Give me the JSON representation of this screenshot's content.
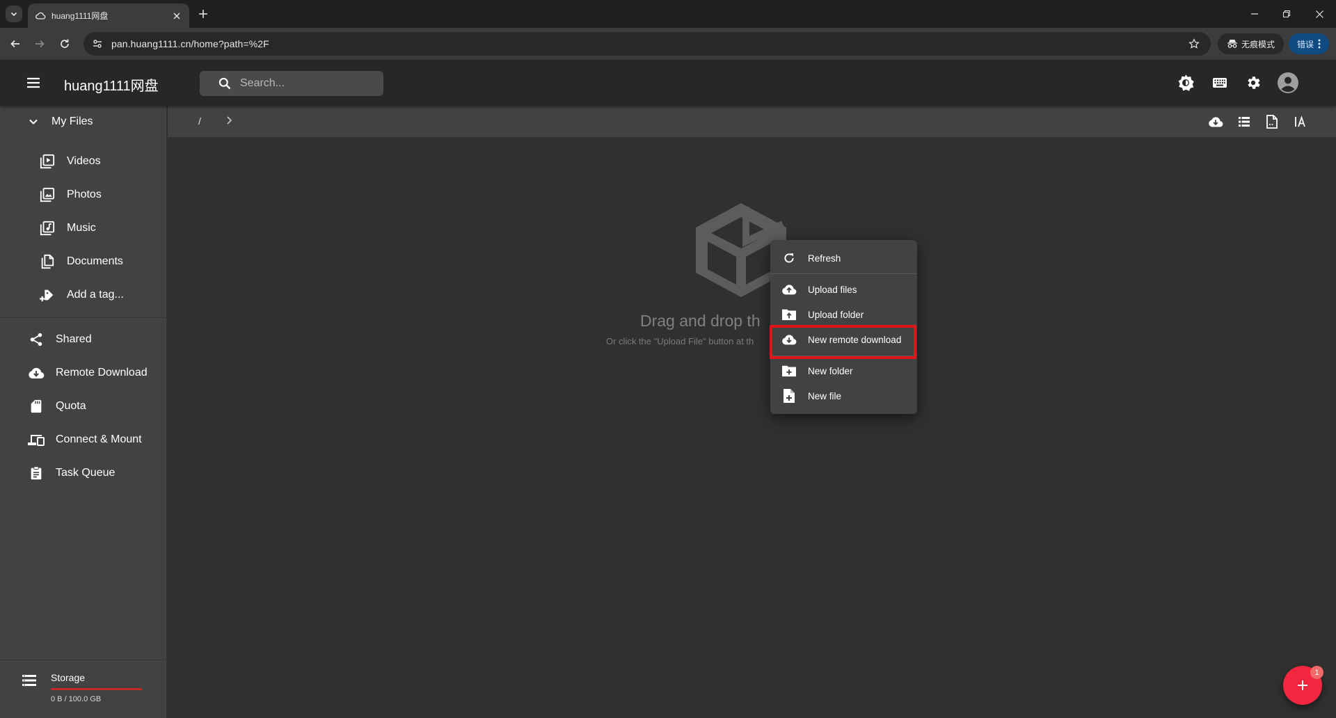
{
  "browser": {
    "tab_title": "huang1111网盘",
    "url": "pan.huang1111.cn/home?path=%2F",
    "incognito_label": "无痕模式",
    "error_label": "错误"
  },
  "header": {
    "title": "huang1111网盘",
    "search_placeholder": "Search..."
  },
  "sidebar": {
    "my_files": "My Files",
    "file_types": [
      {
        "label": "Videos",
        "icon": "video-icon"
      },
      {
        "label": "Photos",
        "icon": "photo-icon"
      },
      {
        "label": "Music",
        "icon": "music-icon"
      },
      {
        "label": "Documents",
        "icon": "documents-icon"
      },
      {
        "label": "Add a tag...",
        "icon": "tag-add-icon"
      }
    ],
    "items": [
      {
        "label": "Shared",
        "icon": "share-icon"
      },
      {
        "label": "Remote Download",
        "icon": "cloud-download-icon"
      },
      {
        "label": "Quota",
        "icon": "sd-card-icon"
      },
      {
        "label": "Connect & Mount",
        "icon": "devices-icon"
      },
      {
        "label": "Task Queue",
        "icon": "clipboard-list-icon"
      }
    ],
    "storage": {
      "title": "Storage",
      "used": "0 B / 100.0 GB"
    }
  },
  "breadcrumb": {
    "root": "/"
  },
  "empty_state": {
    "title": "Drag and drop th",
    "subtitle": "Or click the \"Upload File\" button at th"
  },
  "context_menu": {
    "items": [
      {
        "label": "Refresh",
        "icon": "refresh-icon"
      },
      {
        "label": "Upload files",
        "icon": "cloud-upload-icon"
      },
      {
        "label": "Upload folder",
        "icon": "folder-upload-icon"
      },
      {
        "label": "New remote download",
        "icon": "cloud-download-icon",
        "highlighted": true
      },
      {
        "label": "New folder",
        "icon": "folder-add-icon"
      },
      {
        "label": "New file",
        "icon": "file-add-icon"
      }
    ]
  },
  "fab": {
    "badge": "1"
  },
  "colors": {
    "accent": "#f2263f",
    "highlight_border": "#e0141c",
    "storage_bar": "#c62828"
  }
}
